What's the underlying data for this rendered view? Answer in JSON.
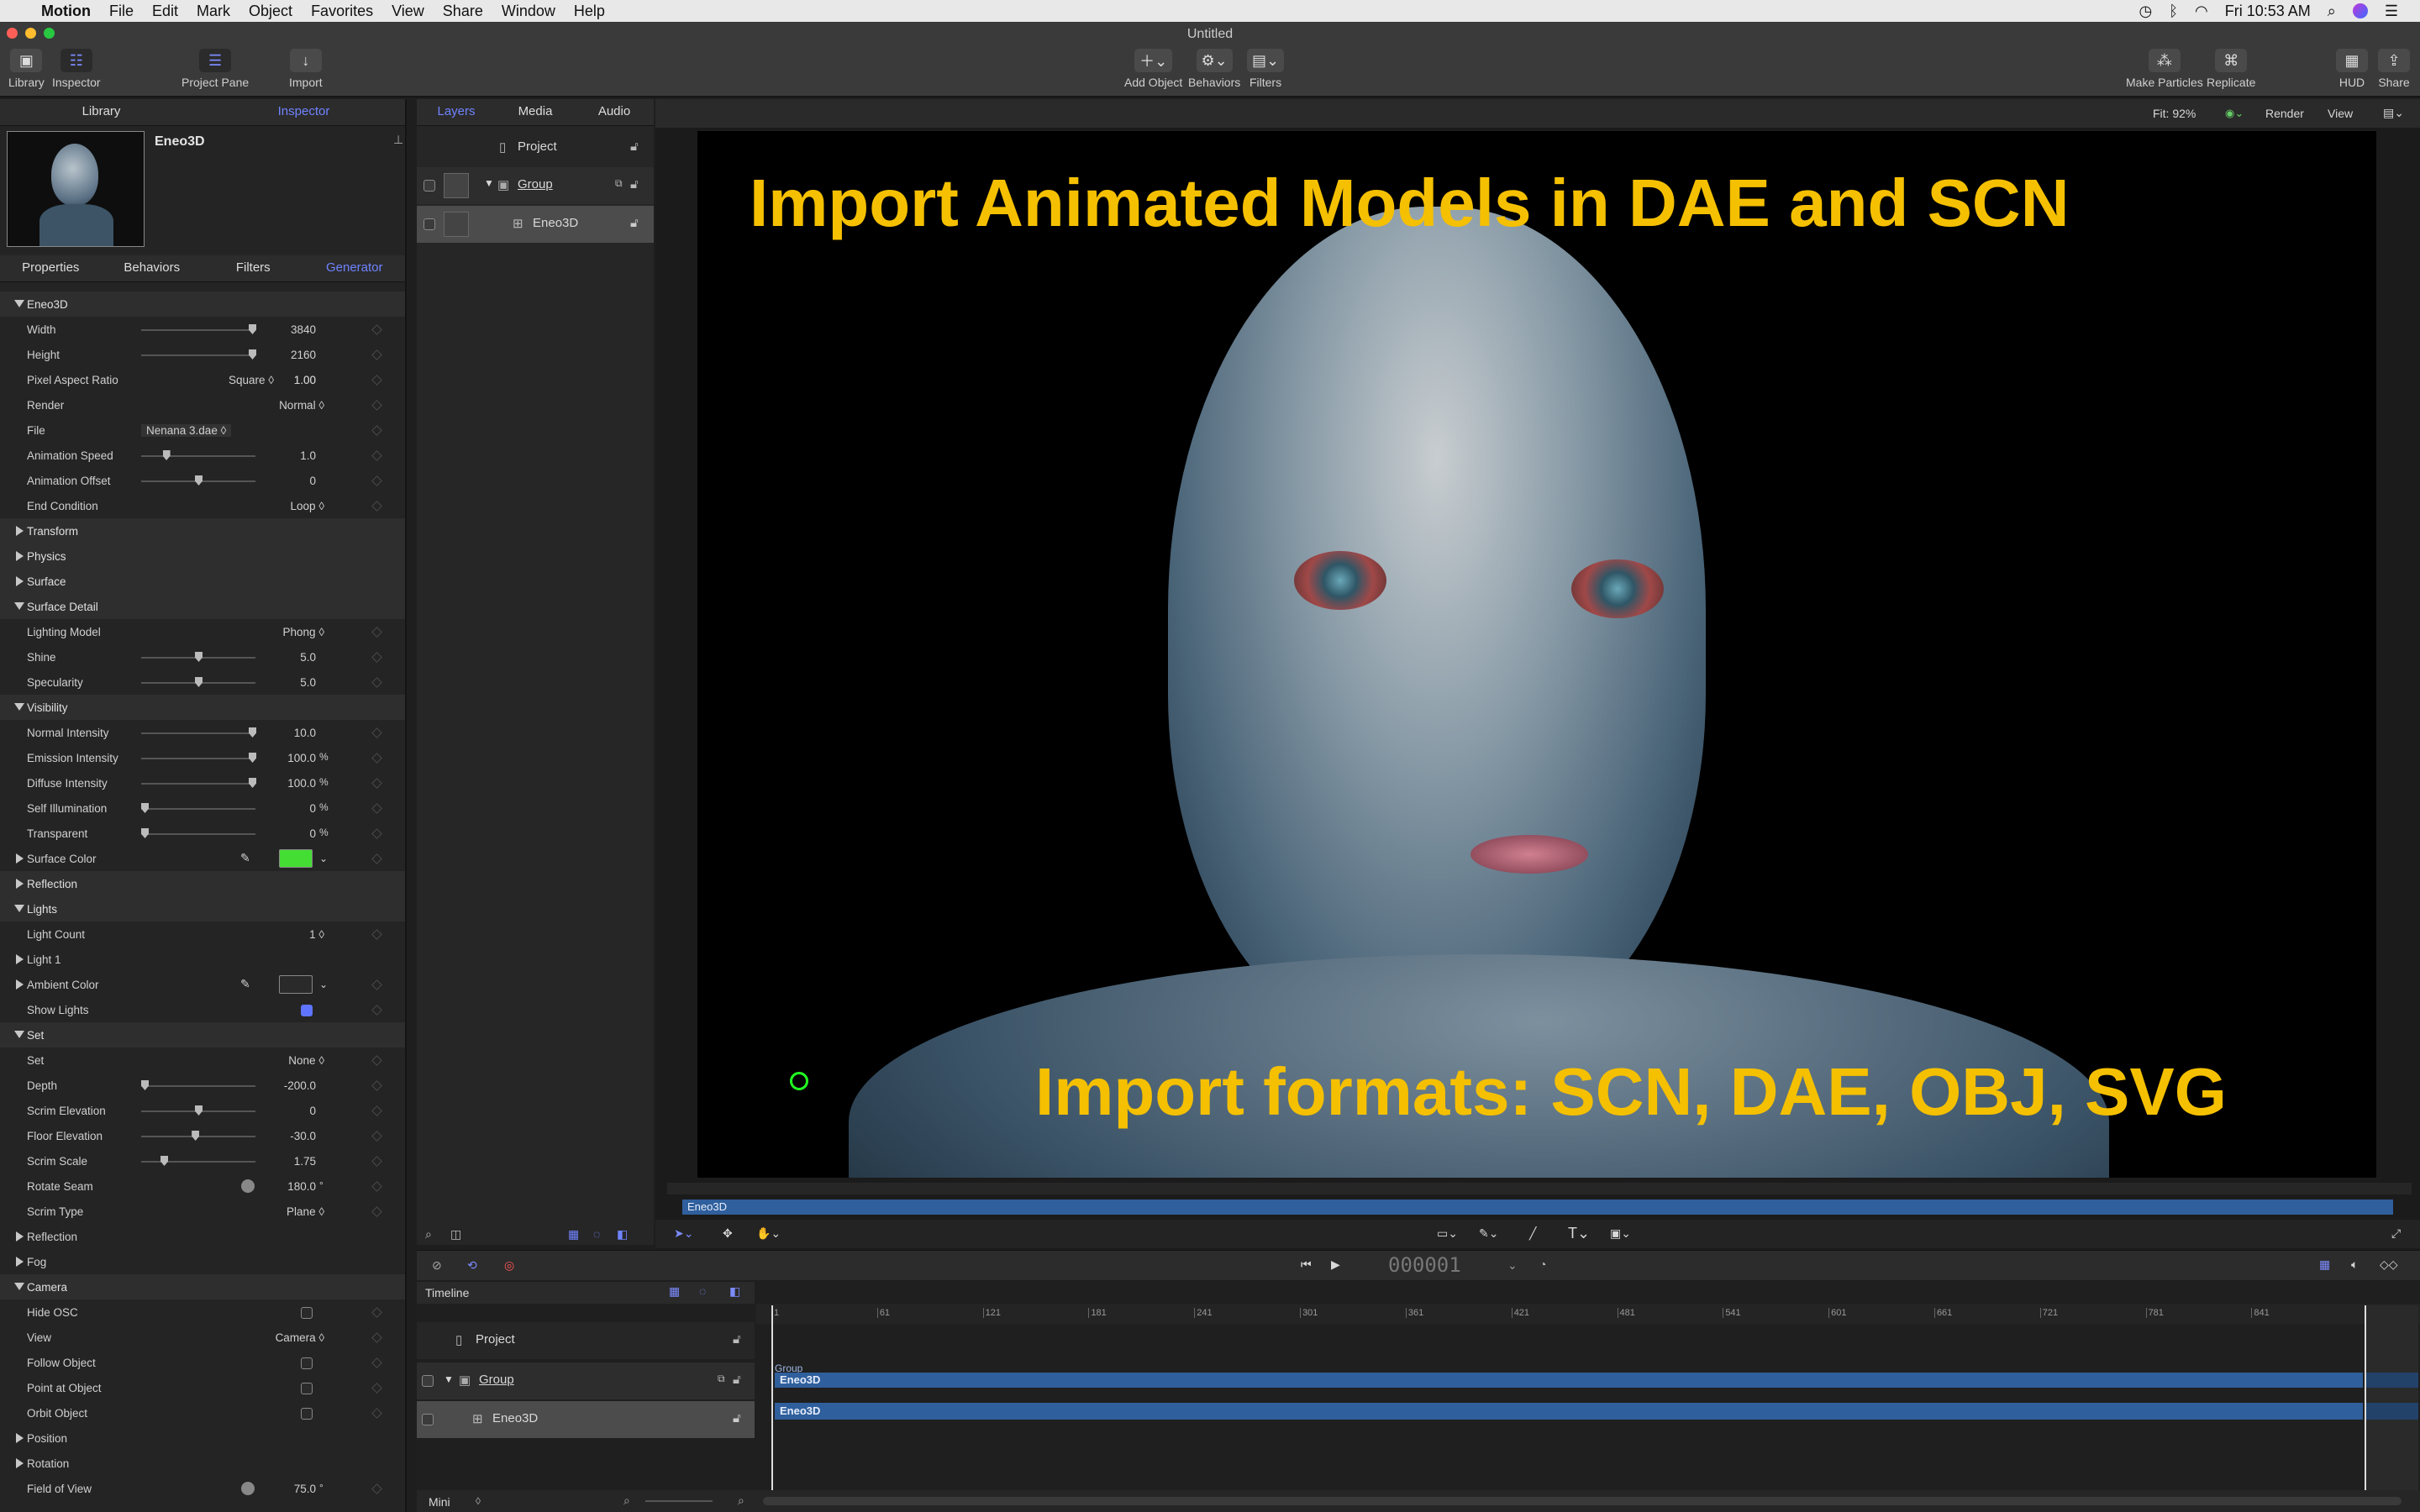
{
  "menubar": {
    "app": "Motion",
    "items": [
      "File",
      "Edit",
      "Mark",
      "Object",
      "Favorites",
      "View",
      "Share",
      "Window",
      "Help"
    ],
    "clock": "Fri 10:53 AM"
  },
  "window": {
    "title": "Untitled"
  },
  "toolbar": {
    "library": "Library",
    "inspector": "Inspector",
    "project_pane": "Project Pane",
    "import": "Import",
    "add_object": "Add Object",
    "behaviors": "Behaviors",
    "filters": "Filters",
    "make_particles": "Make Particles",
    "replicate": "Replicate",
    "hud": "HUD",
    "share": "Share"
  },
  "left_tabs": {
    "library": "Library",
    "inspector": "Inspector"
  },
  "preview": {
    "name": "Eneo3D"
  },
  "insp_tabs": {
    "properties": "Properties",
    "behaviors": "Behaviors",
    "filters": "Filters",
    "generator": "Generator"
  },
  "rows": [
    {
      "t": "sec",
      "label": "Eneo3D",
      "open": true
    },
    {
      "t": "slider",
      "label": "Width",
      "value": "3840",
      "pos": 1.0
    },
    {
      "t": "slider",
      "label": "Height",
      "value": "2160",
      "pos": 1.0
    },
    {
      "t": "popup2",
      "label": "Pixel Aspect Ratio",
      "popup": "Square ◊",
      "value": "1.00"
    },
    {
      "t": "popup",
      "label": "Render",
      "popup": "Normal ◊"
    },
    {
      "t": "file",
      "label": "File",
      "popup": "Nenana 3.dae ◊"
    },
    {
      "t": "slider",
      "label": "Animation Speed",
      "value": "1.0",
      "pos": 0.2
    },
    {
      "t": "slider",
      "label": "Animation Offset",
      "value": "0",
      "pos": 0.5
    },
    {
      "t": "popup",
      "label": "End Condition",
      "popup": "Loop ◊"
    },
    {
      "t": "sec",
      "label": "Transform",
      "open": false
    },
    {
      "t": "sec",
      "label": "Physics",
      "open": false
    },
    {
      "t": "sec",
      "label": "Surface",
      "open": false
    },
    {
      "t": "sec",
      "label": "Surface Detail",
      "open": true
    },
    {
      "t": "popup",
      "label": "Lighting Model",
      "popup": "Phong ◊"
    },
    {
      "t": "slider",
      "label": "Shine",
      "value": "5.0",
      "pos": 0.5
    },
    {
      "t": "slider",
      "label": "Specularity",
      "value": "5.0",
      "pos": 0.5
    },
    {
      "t": "sec",
      "label": "Visibility",
      "open": true
    },
    {
      "t": "slider",
      "label": "Normal Intensity",
      "value": "10.0",
      "pos": 1.0
    },
    {
      "t": "slider",
      "label": "Emission Intensity",
      "value": "100.0",
      "unit": "%",
      "pos": 1.0
    },
    {
      "t": "slider",
      "label": "Diffuse Intensity",
      "value": "100.0",
      "unit": "%",
      "pos": 1.0
    },
    {
      "t": "slider",
      "label": "Self Illumination",
      "value": "0",
      "unit": "%",
      "pos": 0.0
    },
    {
      "t": "slider",
      "label": "Transparent",
      "value": "0",
      "unit": "%",
      "pos": 0.0
    },
    {
      "t": "color",
      "label": "Surface Color",
      "swatch": "#44dd33",
      "closed": true
    },
    {
      "t": "sec",
      "label": "Reflection",
      "open": false
    },
    {
      "t": "sec",
      "label": "Lights",
      "open": true
    },
    {
      "t": "popup",
      "label": "Light Count",
      "popup": "1 ◊"
    },
    {
      "t": "sub",
      "label": "Light 1"
    },
    {
      "t": "color",
      "label": "Ambient Color",
      "swatch": "#2a2a2a",
      "closed": true
    },
    {
      "t": "check",
      "label": "Show Lights",
      "checked": true
    },
    {
      "t": "sec",
      "label": "Set",
      "open": true
    },
    {
      "t": "popup",
      "label": "Set",
      "popup": "None ◊"
    },
    {
      "t": "slider",
      "label": "Depth",
      "value": "-200.0",
      "pos": 0.0
    },
    {
      "t": "slider",
      "label": "Scrim Elevation",
      "value": "0",
      "pos": 0.5
    },
    {
      "t": "slider",
      "label": "Floor Elevation",
      "value": "-30.0",
      "pos": 0.47
    },
    {
      "t": "slider",
      "label": "Scrim Scale",
      "value": "1.75",
      "pos": 0.18
    },
    {
      "t": "dial",
      "label": "Rotate Seam",
      "value": "180.0",
      "unit": "°"
    },
    {
      "t": "popup",
      "label": "Scrim Type",
      "popup": "Plane ◊"
    },
    {
      "t": "sub",
      "label": "Reflection"
    },
    {
      "t": "sub",
      "label": "Fog"
    },
    {
      "t": "sec",
      "label": "Camera",
      "open": true
    },
    {
      "t": "check",
      "label": "Hide OSC",
      "checked": false
    },
    {
      "t": "popup",
      "label": "View",
      "popup": "Camera ◊"
    },
    {
      "t": "check",
      "label": "Follow Object",
      "checked": false
    },
    {
      "t": "check",
      "label": "Point at Object",
      "checked": false
    },
    {
      "t": "check",
      "label": "Orbit Object",
      "checked": false
    },
    {
      "t": "sub",
      "label": "Position"
    },
    {
      "t": "sub",
      "label": "Rotation"
    },
    {
      "t": "dial",
      "label": "Field of View",
      "value": "75.0",
      "unit": "°"
    }
  ],
  "layer_tabs": {
    "layers": "Layers",
    "media": "Media",
    "audio": "Audio"
  },
  "layers": {
    "project": "Project",
    "group": "Group",
    "eneo": "Eneo3D"
  },
  "canvas": {
    "fit": "Fit: 92%",
    "render": "Render",
    "view": "View",
    "title_text": "Import Animated Models in DAE and SCN",
    "bottom_text": "Import formats: SCN, DAE, OBJ, SVG",
    "mini_clip": "Eneo3D"
  },
  "transport": {
    "timecode": "000001"
  },
  "timeline": {
    "label": "Timeline",
    "project": "Project",
    "group": "Group",
    "eneo": "Eneo3D",
    "bar_group": "Group",
    "bar_eneo1": "Eneo3D",
    "bar_eneo2": "Eneo3D",
    "mini": "Mini",
    "ticks": [
      "1",
      "61",
      "121",
      "181",
      "241",
      "301",
      "361",
      "421",
      "481",
      "541",
      "601",
      "661",
      "721",
      "781",
      "841"
    ]
  }
}
